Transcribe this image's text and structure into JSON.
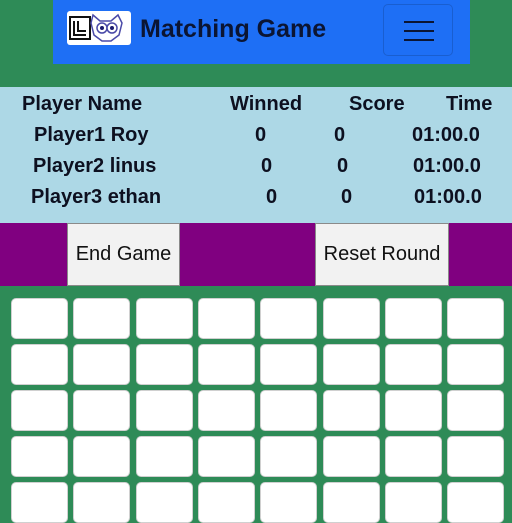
{
  "header": {
    "title": "Matching Game",
    "logo_icon": "owl-logo-icon",
    "menu_icon": "hamburger-menu-icon",
    "brand_color": "#1e6ff5"
  },
  "scoreboard": {
    "headers": [
      "Player Name",
      "Winned",
      "Score",
      "Time"
    ],
    "rows": [
      {
        "name": "Player1 Roy",
        "winned": "0",
        "score": "0",
        "time": "01:00.0"
      },
      {
        "name": "Player2 linus",
        "winned": "0",
        "score": "0",
        "time": "01:00.0"
      },
      {
        "name": "Player3 ethan",
        "winned": "0",
        "score": "0",
        "time": "01:00.0"
      }
    ]
  },
  "controls": {
    "end_game_label": "End Game",
    "reset_round_label": "Reset Round",
    "bar_color": "#800080"
  },
  "board": {
    "columns": 8,
    "visible_rows": 5,
    "card_state": "face-down",
    "background_color": "#2e8b57"
  }
}
